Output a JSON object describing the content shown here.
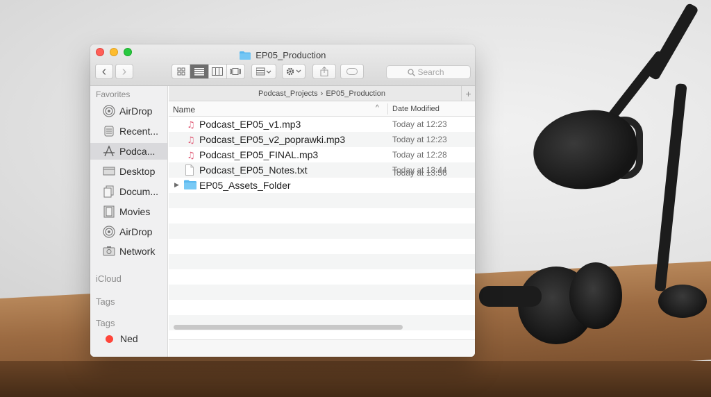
{
  "window": {
    "title": "EP05_Production"
  },
  "toolbar": {
    "back_glyph": "‹",
    "forward_glyph": "›",
    "view_modes": [
      "icon-view",
      "list-view",
      "column-view",
      "gallery-view"
    ],
    "active_view": "list-view",
    "search_placeholder": "Search"
  },
  "sidebar": {
    "favorites_header": "Favorites",
    "items": [
      {
        "label": "AirDrop",
        "icon": "airdrop-icon"
      },
      {
        "label": "Recent...",
        "icon": "recents-icon"
      },
      {
        "label": "Podca...",
        "icon": "applications-icon",
        "selected": true
      },
      {
        "label": "Desktop",
        "icon": "desktop-icon"
      },
      {
        "label": "Docum...",
        "icon": "documents-icon"
      },
      {
        "label": "Movies",
        "icon": "movies-icon"
      },
      {
        "label": "AirDrop",
        "icon": "airdrop-icon"
      },
      {
        "label": "Network",
        "icon": "network-icon"
      }
    ],
    "icloud_header": "iCloud",
    "tags_header_1": "Tags",
    "tags_header_2": "Tags",
    "tag_items": [
      {
        "label": "Ned",
        "color": "#ff453a"
      }
    ]
  },
  "path": {
    "parent": "Podcast_Projects",
    "separator": "›",
    "current": "EP05_Production",
    "add_glyph": "+"
  },
  "columns": {
    "name": "Name",
    "date_modified": "Date Modified",
    "sort_glyph": "^"
  },
  "files": [
    {
      "name": "Podcast_EP05_v1.mp3",
      "date": "Today at 12:23",
      "type": "audio"
    },
    {
      "name": "Podcast_EP05_v2_poprawki.mp3",
      "date": "Today at 12:23",
      "type": "audio"
    },
    {
      "name": "Podcast_EP05_FINAL.mp3",
      "date": "Today at 12:28",
      "type": "audio"
    },
    {
      "name": "Podcast_EP05_Notes.txt",
      "date": "Today at 13:44",
      "type": "text"
    },
    {
      "name": "EP05_Assets_Folder",
      "date": "Today at 13:56",
      "type": "folder"
    }
  ],
  "colors": {
    "accent_folder": "#5ab8ef",
    "tag_red": "#ff453a"
  }
}
